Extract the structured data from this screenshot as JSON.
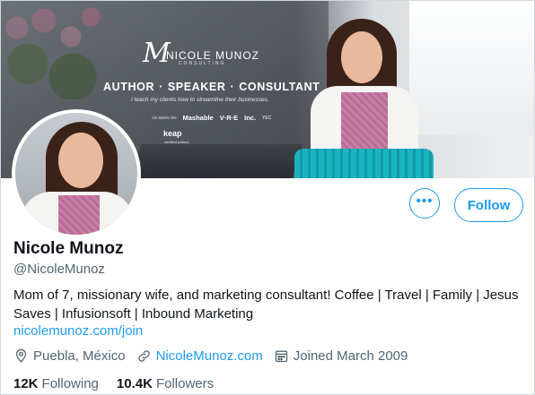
{
  "banner": {
    "brand_mark": "M",
    "brand_name": "NICOLE MUNOZ",
    "brand_sub": "CONSULTING",
    "roles": [
      "AUTHOR",
      "SPEAKER",
      "CONSULTANT"
    ],
    "role_separator": "·",
    "tagline": "I teach my clients how to streamline their businesses.",
    "as_seen_on": "AS SEEN ON",
    "logos": [
      "Mashable",
      "V·R·E",
      "Inc.",
      "YEC"
    ],
    "keap_logo": "keap",
    "keap_sub": "certified partner"
  },
  "actions": {
    "more_label": "•••",
    "follow_label": "Follow"
  },
  "profile": {
    "display_name": "Nicole Munoz",
    "handle": "@NicoleMunoz",
    "bio": "Mom of 7, missionary wife, and marketing consultant! Coffee | Travel | Family | Jesus Saves | Infusionsoft | Inbound Marketing",
    "bio_link": "nicolemunoz.com/join",
    "location": "Puebla, México",
    "website": "NicoleMunoz.com",
    "joined": "Joined March 2009"
  },
  "stats": {
    "following_count": "12K",
    "following_label": "Following",
    "followers_count": "10.4K",
    "followers_label": "Followers"
  },
  "colors": {
    "accent": "#1d9bf0",
    "secondary_text": "#536471",
    "primary_text": "#0f1419"
  },
  "icons": {
    "location": "location-pin-icon",
    "website": "link-icon",
    "joined": "calendar-icon"
  }
}
